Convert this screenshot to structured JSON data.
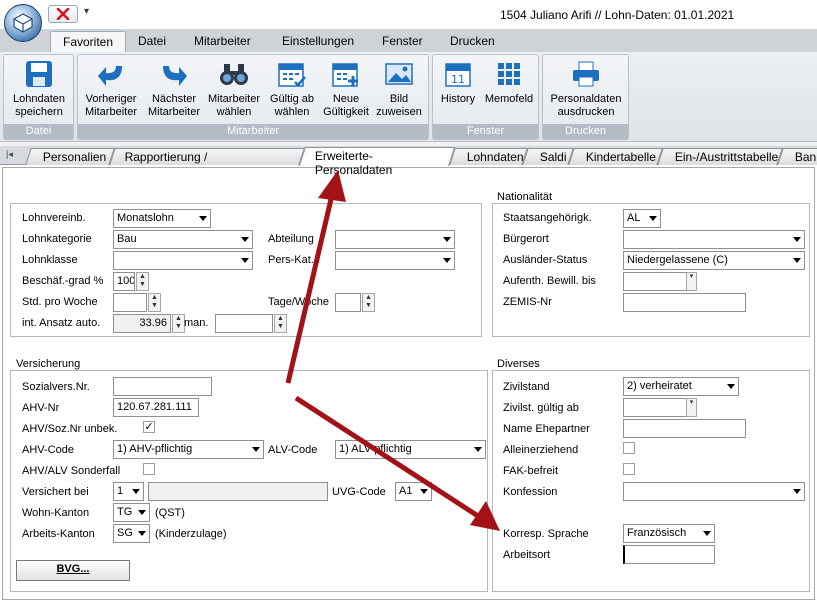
{
  "window": {
    "title": "1504 Juliano Arifi // Lohn-Daten: 01.01.2021",
    "qat_menu": "▾"
  },
  "menu_tabs": [
    "Favoriten",
    "Datei",
    "Mitarbeiter",
    "Einstellungen",
    "Fenster",
    "Drucken"
  ],
  "ribbon": {
    "groups": {
      "datei": "Datei",
      "mitarbeiter": "Mitarbeiter",
      "fenster": "Fenster",
      "drucken": "Drucken"
    },
    "buttons": {
      "save": [
        "Lohndaten",
        "speichern"
      ],
      "prev": [
        "Vorheriger",
        "Mitarbeiter"
      ],
      "next": [
        "Nächster",
        "Mitarbeiter"
      ],
      "choose": [
        "Mitarbeiter",
        "wählen"
      ],
      "valid": [
        "Gültig ab",
        "wählen"
      ],
      "newvalid": [
        "Neue",
        "Gültigkeit"
      ],
      "image": [
        "Bild",
        "zuweisen"
      ],
      "history": [
        "History",
        ""
      ],
      "memo": [
        "Memofeld",
        ""
      ],
      "print": [
        "Personaldaten",
        "ausdrucken"
      ]
    }
  },
  "sub_tabs": {
    "personalien": "Personalien",
    "rapport": "Rapportierung / Kostenrechnung",
    "erweitert": "Erweiterte-Personaldaten",
    "lohndaten": "Lohndaten",
    "saldi": "Saldi",
    "kinder": "Kindertabelle",
    "einaus": "Ein-/Austrittstabelle",
    "bank": "Bank"
  },
  "lohn": {
    "lohnvereinbarung": {
      "label": "Lohnvereinb.",
      "value": "Monatslohn"
    },
    "lohnkategorie": {
      "label": "Lohnkategorie",
      "value": "Bau"
    },
    "lohnklasse": {
      "label": "Lohnklasse",
      "value": ""
    },
    "beschaeftigungsgrad": {
      "label": "Beschäf.-grad %",
      "value": "100"
    },
    "std_pro_woche": {
      "label": "Std. pro Woche",
      "value": ""
    },
    "ansatz": {
      "label": "int. Ansatz auto.",
      "value": "33.96",
      "man_label": "man.",
      "man_value": ""
    },
    "abteilung": {
      "label": "Abteilung",
      "value": ""
    },
    "pers_kat": {
      "label": "Pers-Kat.",
      "value": ""
    },
    "tage_woche": {
      "label": "Tage/Woche",
      "value": ""
    }
  },
  "nationalitaet": {
    "title": "Nationalität",
    "staatsangehoerigkeit": {
      "label": "Staatsangehörigk.",
      "value": "AL"
    },
    "buergerort": {
      "label": "Bürgerort",
      "value": ""
    },
    "auslaender_status": {
      "label": "Ausländer-Status",
      "value": "Niedergelassene (C)"
    },
    "aufenthalt": {
      "label": "Aufenth. Bewill. bis",
      "value": ""
    },
    "zemis": {
      "label": "ZEMIS-Nr",
      "value": ""
    }
  },
  "versicherung": {
    "title": "Versicherung",
    "sozialvers": {
      "label": "Sozialvers.Nr.",
      "value": ""
    },
    "ahv_nr": {
      "label": "AHV-Nr",
      "value": "120.67.281.111"
    },
    "ahv_unbek": {
      "label": "AHV/Soz.Nr unbek.",
      "checked": "✓"
    },
    "ahv_code": {
      "label": "AHV-Code",
      "value": "1) AHV-pflichtig"
    },
    "alv_code": {
      "label": "ALV-Code",
      "value": "1) ALV-pflichtig"
    },
    "sonderfall": {
      "label": "AHV/ALV Sonderfall",
      "checked": ""
    },
    "versichert_bei": {
      "label": "Versichert bei",
      "value": "1",
      "extra": ""
    },
    "uvg_code": {
      "label": "UVG-Code",
      "value": "A1"
    },
    "wohn_kanton": {
      "label": "Wohn-Kanton",
      "value": "TG",
      "note": "(QST)"
    },
    "arbeits_kanton": {
      "label": "Arbeits-Kanton",
      "value": "SG",
      "note": "(Kinderzulage)"
    },
    "bvg_button": "BVG..."
  },
  "diverses": {
    "title": "Diverses",
    "zivilstand": {
      "label": "Zivilstand",
      "value": "2) verheiratet"
    },
    "zivil_gueltig": {
      "label": "Zivilst. gültig ab",
      "value": ""
    },
    "ehepartner": {
      "label": "Name Ehepartner",
      "value": ""
    },
    "alleinerziehend": {
      "label": "Alleinerziehend",
      "checked": ""
    },
    "fak_befreit": {
      "label": "FAK-befreit",
      "checked": ""
    },
    "konfession": {
      "label": "Konfession",
      "value": ""
    },
    "sprache": {
      "label": "Korresp. Sprache",
      "value": "Französisch"
    },
    "arbeitsort": {
      "label": "Arbeitsort",
      "value": ""
    }
  },
  "colors": {
    "arrow": "#a31217",
    "ribbon_label": "#b4bbc5",
    "accent": "#1f6fc0"
  }
}
